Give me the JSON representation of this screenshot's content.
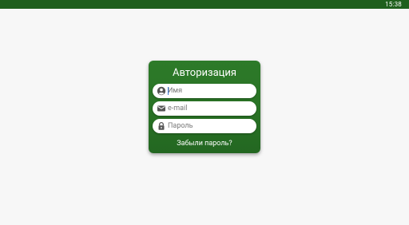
{
  "status_bar": {
    "time": "15:38",
    "color": "#1f5f1d"
  },
  "login_card": {
    "title": "Авторизация",
    "accent_color": "#2a7426",
    "fields": {
      "name": {
        "placeholder": "Имя",
        "value": "",
        "icon": "person-icon"
      },
      "email": {
        "placeholder": "e-mail",
        "value": "",
        "icon": "mail-icon"
      },
      "password": {
        "placeholder": "Пароль",
        "value": "",
        "icon": "lock-icon"
      }
    },
    "forgot_password": "Забыли пароль?"
  }
}
